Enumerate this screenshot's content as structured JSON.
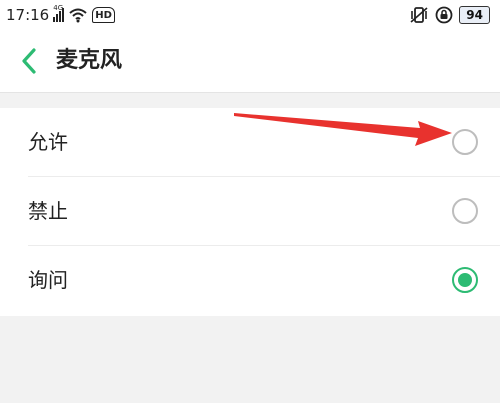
{
  "status_bar": {
    "time": "17:16",
    "network": "4G",
    "hd": "HD",
    "battery": "94"
  },
  "header": {
    "title": "麦克风",
    "back_icon": "chevron-left-icon"
  },
  "options": [
    {
      "label": "允许",
      "selected": false
    },
    {
      "label": "禁止",
      "selected": false
    },
    {
      "label": "询问",
      "selected": true
    }
  ],
  "colors": {
    "accent": "#2dbb73",
    "annotation_arrow": "#e8322e"
  }
}
